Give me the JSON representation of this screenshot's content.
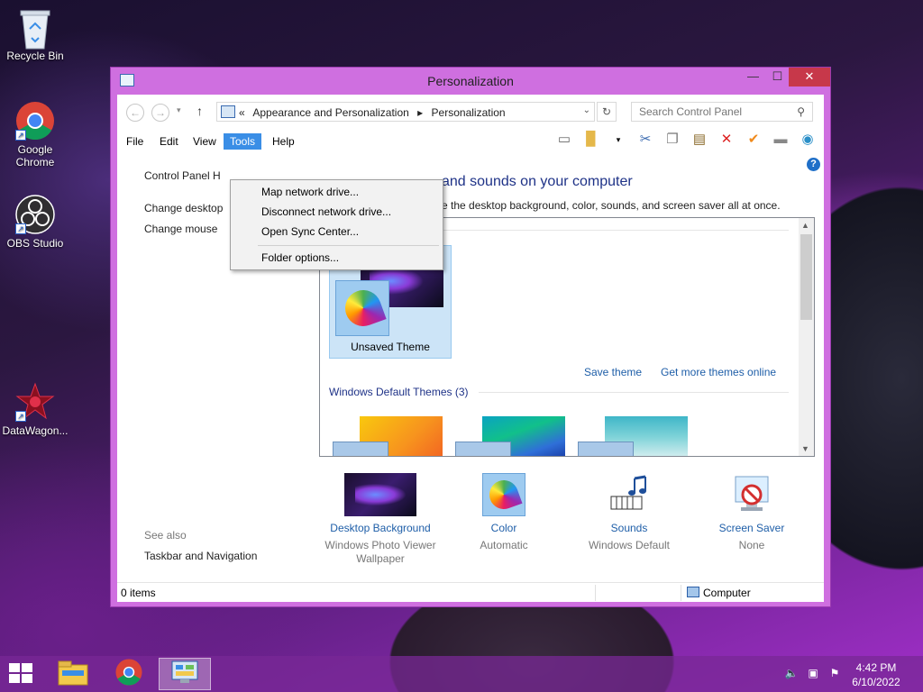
{
  "desktop": {
    "icons": [
      {
        "label": "Recycle Bin"
      },
      {
        "label": "Google Chrome"
      },
      {
        "label": "OBS Studio"
      },
      {
        "label": "DataWagon..."
      }
    ]
  },
  "window": {
    "title": "Personalization",
    "controls": {
      "minimize": "—",
      "maximize": "☐",
      "close": "✕"
    },
    "address": {
      "prefix": "«",
      "crumbs": [
        "Appearance and Personalization",
        "▸",
        "Personalization"
      ]
    },
    "search": {
      "placeholder": "Search Control Panel"
    },
    "menu": [
      "File",
      "Edit",
      "View",
      "Tools",
      "Help"
    ],
    "tools_menu": {
      "items": [
        "Map network drive...",
        "Disconnect network drive...",
        "Open Sync Center...",
        "Folder options..."
      ]
    },
    "left_pane": {
      "links": [
        "Control Panel H",
        "Change desktop",
        "Change mouse"
      ],
      "see_also": "See also",
      "see_also_links": [
        "Taskbar and Navigation"
      ]
    },
    "main": {
      "heading": "and sounds on your computer",
      "subheading": "e the desktop background, color, sounds, and screen saver all at once."
    },
    "themes": {
      "unsaved_label": "Unsaved Theme",
      "save_theme": "Save theme",
      "get_more": "Get more themes online",
      "default_section": "Windows Default Themes (3)"
    },
    "bottom": [
      {
        "label": "Desktop Background",
        "sub": "Windows Photo Viewer Wallpaper"
      },
      {
        "label": "Color",
        "sub": "Automatic"
      },
      {
        "label": "Sounds",
        "sub": "Windows Default"
      },
      {
        "label": "Screen Saver",
        "sub": "None"
      }
    ],
    "status": {
      "items": "0 items",
      "location": "Computer"
    }
  },
  "taskbar": {
    "time": "4:42 PM",
    "date": "6/10/2022"
  }
}
